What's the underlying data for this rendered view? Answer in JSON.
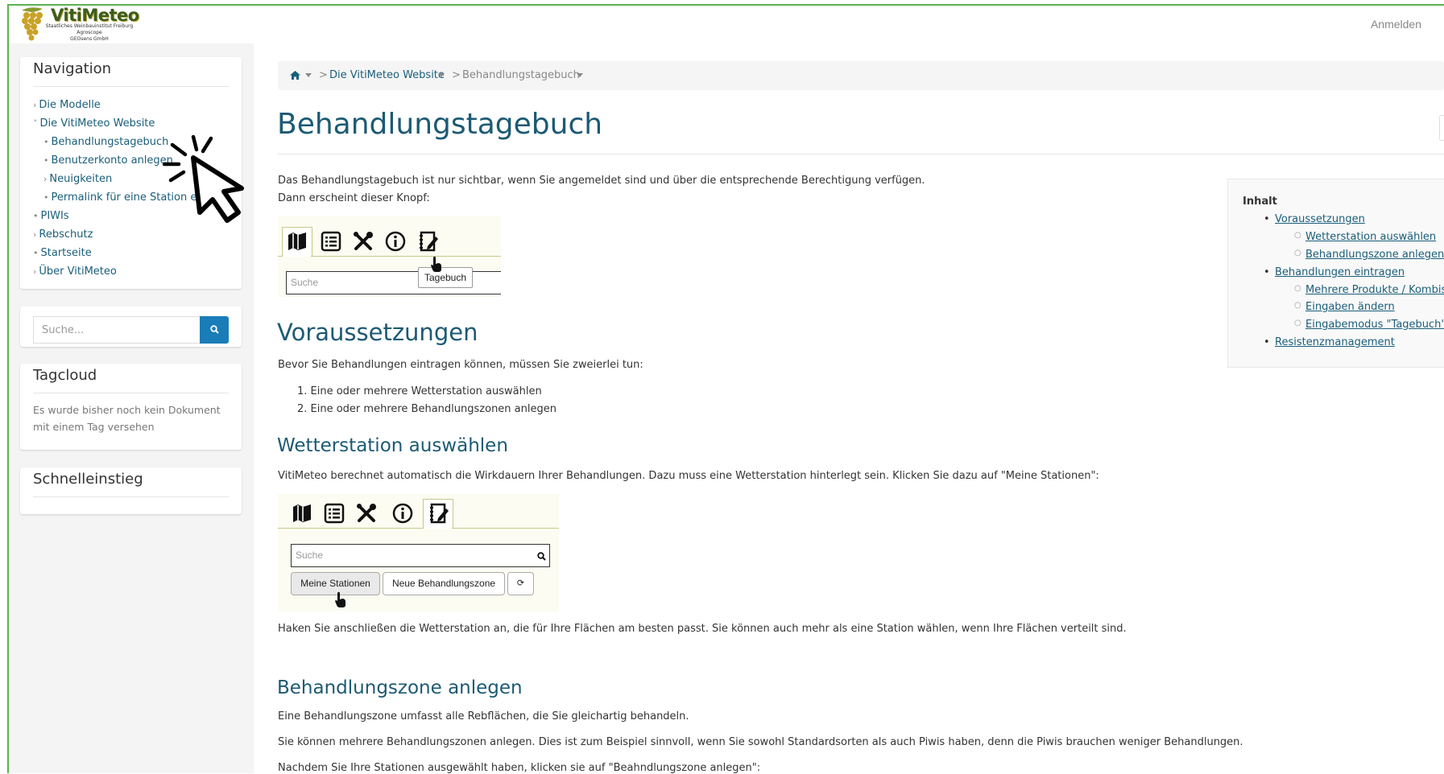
{
  "header": {
    "logo_title": "VitiMeteo",
    "logo_lines": [
      "Staatliches Weinbauinstitut Freiburg",
      "Agroscope",
      "GEOsens GmbH"
    ],
    "login_label": "Anmelden"
  },
  "sidebar": {
    "nav_title": "Navigation",
    "nav_items": [
      {
        "label": "Die Modelle",
        "marker": "›"
      },
      {
        "label": "Die VitiMeteo Website",
        "marker": "˅"
      },
      {
        "label": "Behandlungstagebuch",
        "marker": "•"
      },
      {
        "label": "Benutzerkonto anlegen",
        "marker": "•"
      },
      {
        "label": "Neuigkeiten",
        "marker": "›"
      },
      {
        "label": "Permalink für eine Station erstellen",
        "marker": "•"
      },
      {
        "label": "PIWIs",
        "marker": "•"
      },
      {
        "label": "Rebschutz",
        "marker": "›"
      },
      {
        "label": "Startseite",
        "marker": "•"
      },
      {
        "label": "Über VitiMeteo",
        "marker": "›"
      }
    ],
    "search_placeholder": "Suche...",
    "tagcloud_title": "Tagcloud",
    "tagcloud_text_1": "Es wurde bisher noch kein Dokument",
    "tagcloud_text_2": "mit einem Tag versehen",
    "quick_title": "Schnelleinstieg"
  },
  "breadcrumb": {
    "sep": ">",
    "site": "Die VitiMeteo Website",
    "current": "Behandlungstagebuch"
  },
  "main": {
    "title": "Behandlungstagebuch",
    "intro_1": "Das Behandlungstagebuch ist nur sichtbar, wenn Sie angemeldet sind und über die entsprechende Berechtigung verfügen.",
    "intro_2": "Dann erscheint dieser Knopf:",
    "img1_search": "Suche",
    "img1_tooltip": "Tagebuch",
    "sec1_title": "Voraussetzungen",
    "sec1_text": "Bevor Sie Behandlungen eintragen können, müssen Sie zweierlei tun:",
    "sec1_list": [
      "1. Eine oder mehrere Wetterstation auswählen",
      "2. Eine oder mehrere Behandlungszonen anlegen"
    ],
    "sub1_title": "Wetterstation auswählen",
    "sub1_text": "VitiMeteo berechnet automatisch die Wirkdauern Ihrer Behandlungen. Dazu muss eine Wetterstation hinterlegt sein.  Klicken Sie dazu auf \"Meine Stationen\":",
    "img2_search": "Suche",
    "img2_btn1": "Meine Stationen",
    "img2_btn2": "Neue Behandlungszone",
    "img2_btn3": "⟳",
    "sub1_after": "Haken Sie anschließen die Wetterstation an,  die für Ihre Flächen am besten passt. Sie können auch mehr als eine Station wählen, wenn Ihre Flächen verteilt sind.",
    "sub2_title": "Behandlungszone anlegen",
    "sub2_text_1": "Eine Behandlungszone umfasst alle Rebflächen, die Sie gleichartig behandeln.",
    "sub2_text_2": "Sie können mehrere Behandlungszonen anlegen. Dies ist zum Beispiel sinnvoll, wenn Sie sowohl Standardsorten als auch Piwis haben, denn die Piwis brauchen weniger Behandlungen.",
    "sub2_text_3": "Nachdem Sie Ihre Stationen ausgewählt haben, klicken sie auf \"Beahndlungszone anlegen\":"
  },
  "toc": {
    "title": "Inhalt",
    "items": [
      {
        "label": "Voraussetzungen",
        "level": 1
      },
      {
        "label": "Wetterstation auswählen",
        "level": 2
      },
      {
        "label": "Behandlungszone anlegen",
        "level": 2
      },
      {
        "label": "Behandlungen eintragen",
        "level": 1
      },
      {
        "label": "Mehrere Produkte / Kombis",
        "level": 2
      },
      {
        "label": "Eingaben ändern",
        "level": 2
      },
      {
        "label": "Eingabemodus \"Tagebuch\"",
        "level": 2
      },
      {
        "label": "Resistenzmanagement",
        "level": 1
      }
    ]
  },
  "colors": {
    "accent": "#1c5a74",
    "link": "#1a5e7a",
    "search_button": "#1a7db8",
    "frame": "#5bb24f"
  },
  "icons": [
    "home-icon",
    "search-icon",
    "map-icon",
    "list-icon",
    "tools-icon",
    "info-icon",
    "diary-icon",
    "cursor-icon"
  ]
}
